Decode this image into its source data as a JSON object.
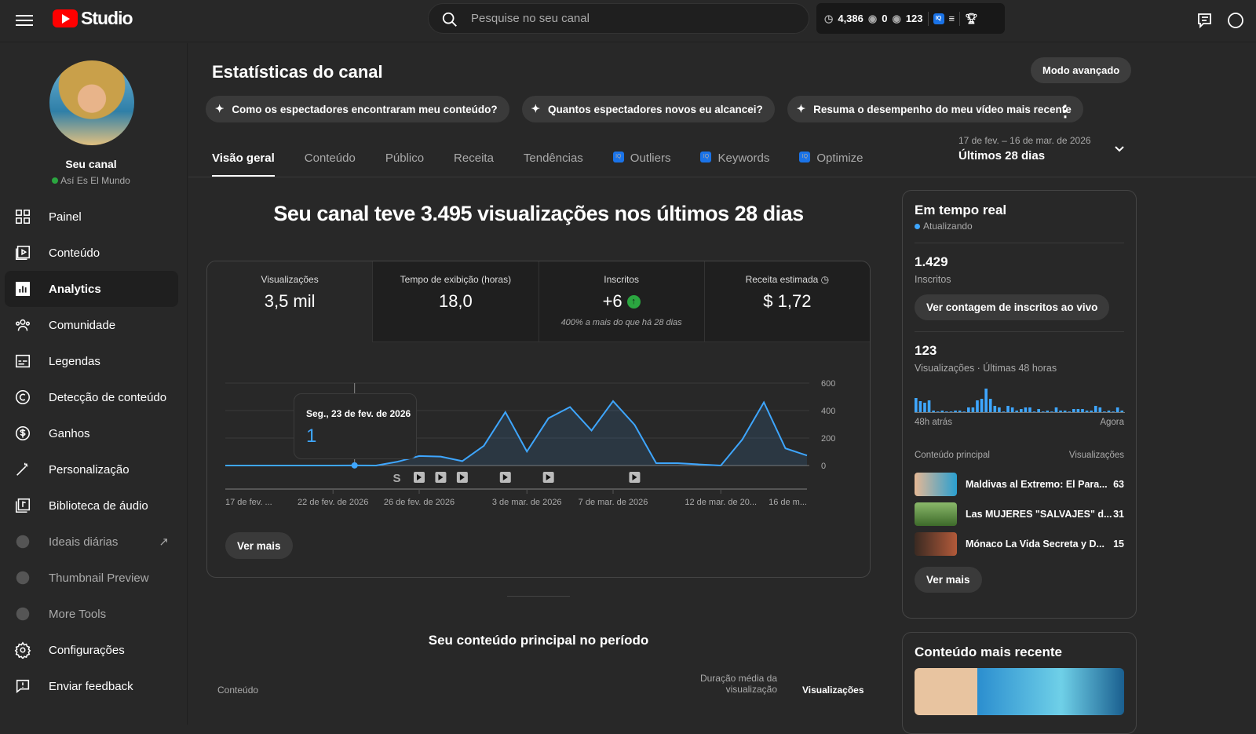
{
  "topbar": {
    "logo_text": "Studio",
    "search_placeholder": "Pesquise no seu canal",
    "stats": {
      "watch_hours": "4,386",
      "views_a": "0",
      "views_b": "123"
    }
  },
  "channel": {
    "name": "Seu canal",
    "subtitle": "Así Es El Mundo"
  },
  "sidebar": {
    "items": [
      {
        "label": "Painel",
        "icon": "dashboard-icon"
      },
      {
        "label": "Conteúdo",
        "icon": "content-icon"
      },
      {
        "label": "Analytics",
        "icon": "analytics-icon"
      },
      {
        "label": "Comunidade",
        "icon": "community-icon"
      },
      {
        "label": "Legendas",
        "icon": "subtitles-icon"
      },
      {
        "label": "Detecção de conteúdo",
        "icon": "copyright-icon"
      },
      {
        "label": "Ganhos",
        "icon": "dollar-icon"
      },
      {
        "label": "Personalização",
        "icon": "magic-wand-icon"
      },
      {
        "label": "Biblioteca de áudio",
        "icon": "audio-library-icon"
      },
      {
        "label": "Ideais diárias",
        "icon": "vidiq-icon"
      },
      {
        "label": "Thumbnail Preview",
        "icon": "vidiq-icon"
      },
      {
        "label": "More Tools",
        "icon": "vidiq-icon"
      },
      {
        "label": "Configurações",
        "icon": "gear-icon"
      },
      {
        "label": "Enviar feedback",
        "icon": "feedback-icon"
      }
    ]
  },
  "main": {
    "title": "Estatísticas do canal",
    "advanced_button": "Modo avançado",
    "chips": [
      "Como os espectadores encontraram meu conteúdo?",
      "Quantos espectadores novos eu alcancei?",
      "Resuma o desempenho do meu vídeo mais recente"
    ],
    "tabs": [
      "Visão geral",
      "Conteúdo",
      "Público",
      "Receita",
      "Tendências",
      "Outliers",
      "Keywords",
      "Optimize"
    ],
    "date_range": {
      "dates": "17 de fev. – 16 de mar. de 2026",
      "label": "Últimos 28 dias"
    },
    "headline": "Seu canal teve 3.495 visualizações nos últimos 28 dias",
    "metrics": [
      {
        "label": "Visualizações",
        "value": "3,5 mil"
      },
      {
        "label": "Tempo de exibição (horas)",
        "value": "18,0"
      },
      {
        "label": "Inscritos",
        "value": "+6",
        "note": "400% a mais do que há 28 dias"
      },
      {
        "label": "Receita estimada",
        "value": "$ 1,72"
      }
    ],
    "tooltip": {
      "date": "Seg., 23 de fev. de 2026",
      "value": "1"
    },
    "see_more": "Ver mais",
    "top_content_title": "Seu conteúdo principal no período",
    "table_headers": [
      "Conteúdo",
      "Duração média da visualização",
      "Visualizações"
    ]
  },
  "chart_data": {
    "type": "area",
    "title": "Visualizações",
    "x_start": "17 de fev. de 2026",
    "days": 28,
    "values": [
      0,
      0,
      0,
      0,
      0,
      0,
      1,
      0,
      28,
      69,
      65,
      32,
      143,
      389,
      102,
      344,
      426,
      255,
      469,
      296,
      17,
      17,
      8,
      0,
      190,
      460,
      125,
      73
    ],
    "ylim": [
      0,
      600
    ],
    "yticks": [
      "0",
      "200",
      "400",
      "600"
    ],
    "xticks": [
      {
        "i": 0,
        "label": "17 de fev. ..."
      },
      {
        "i": 5,
        "label": "22 de fev. de 2026"
      },
      {
        "i": 9,
        "label": "26 de fev. de 2026"
      },
      {
        "i": 14,
        "label": "3 de mar. de 2026"
      },
      {
        "i": 18,
        "label": "7 de mar. de 2026"
      },
      {
        "i": 23,
        "label": "12 de mar. de 20..."
      },
      {
        "i": 27,
        "label": "16 de m..."
      }
    ],
    "markers": [
      {
        "i": 8,
        "kind": "short"
      },
      {
        "i": 9,
        "kind": "video"
      },
      {
        "i": 10,
        "kind": "video"
      },
      {
        "i": 11,
        "kind": "video"
      },
      {
        "i": 13,
        "kind": "video"
      },
      {
        "i": 15,
        "kind": "video"
      },
      {
        "i": 19,
        "kind": "video"
      }
    ],
    "highlight_index": 6,
    "color": "#3ea6ff"
  },
  "realtime": {
    "title": "Em tempo real",
    "status": "Atualizando",
    "subs": "1.429",
    "subs_label": "Inscritos",
    "live_button": "Ver contagem de inscritos ao vivo",
    "views": "123",
    "views_label": "Visualizações · Últimas 48 horas",
    "from_label": "48h atrás",
    "to_label": "Agora",
    "col_content": "Conteúdo principal",
    "col_views": "Visualizações",
    "bars": [
      18,
      14,
      12,
      15,
      2,
      0,
      2,
      0,
      0,
      2,
      2,
      0,
      6,
      6,
      15,
      17,
      30,
      17,
      8,
      6,
      0,
      8,
      6,
      2,
      4,
      6,
      6,
      0,
      4,
      0,
      2,
      0,
      6,
      2,
      2,
      0,
      4,
      4,
      4,
      2,
      2,
      8,
      6,
      0,
      2,
      0,
      6,
      2
    ],
    "videos": [
      {
        "title": "Maldivas al Extremo: El Para...",
        "views": "63"
      },
      {
        "title": "Las MUJERES \"SALVAJES\" d...",
        "views": "31"
      },
      {
        "title": "Mónaco La Vida Secreta y D...",
        "views": "15"
      }
    ],
    "see_more": "Ver mais"
  },
  "recent": {
    "title": "Conteúdo mais recente"
  }
}
